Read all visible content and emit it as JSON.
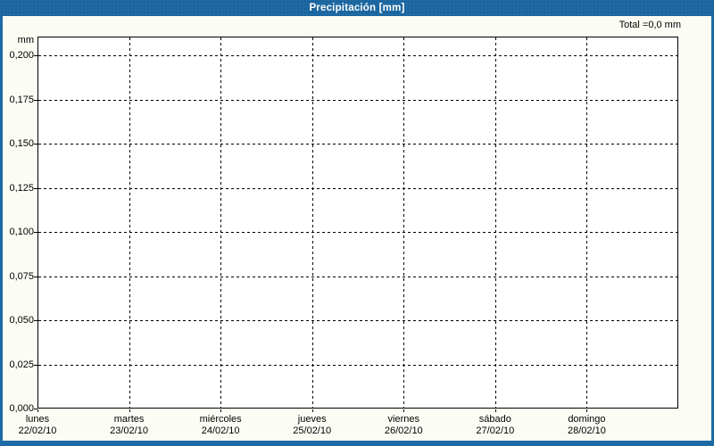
{
  "header": {
    "title": "Precipitación [mm]"
  },
  "total_label": "Total =0,0 mm",
  "y_axis": {
    "unit": "mm",
    "tick_labels": [
      "0,200",
      "0,175",
      "0,150",
      "0,125",
      "0,100",
      "0,075",
      "0,050",
      "0,025",
      "0,000"
    ]
  },
  "x_axis": {
    "days": [
      {
        "name": "lunes",
        "date": "22/02/10"
      },
      {
        "name": "martes",
        "date": "23/02/10"
      },
      {
        "name": "miércoles",
        "date": "24/02/10"
      },
      {
        "name": "jueves",
        "date": "25/02/10"
      },
      {
        "name": "viernes",
        "date": "26/02/10"
      },
      {
        "name": "sábado",
        "date": "27/02/10"
      },
      {
        "name": "domingo",
        "date": "28/02/10"
      }
    ]
  },
  "colors": {
    "frame_blue": "#1E6AA5",
    "background": "#FBFDF5",
    "plot_background": "#FFFFFF",
    "grid": "#000000",
    "title_text": "#FFFFFF",
    "label_text": "#000000"
  },
  "chart_data": {
    "type": "bar",
    "title": "Precipitación [mm]",
    "xlabel": "",
    "ylabel": "mm",
    "categories": [
      "lunes 22/02/10",
      "martes 23/02/10",
      "miércoles 24/02/10",
      "jueves 25/02/10",
      "viernes 26/02/10",
      "sábado 27/02/10",
      "domingo 28/02/10"
    ],
    "values": [
      0,
      0,
      0,
      0,
      0,
      0,
      0
    ],
    "total": "0,0 mm",
    "ylim": [
      0,
      0.21
    ],
    "yticks": [
      0.2,
      0.175,
      0.15,
      0.125,
      0.1,
      0.075,
      0.05,
      0.025,
      0.0
    ],
    "grid": "dashed-both",
    "legend": "none"
  }
}
